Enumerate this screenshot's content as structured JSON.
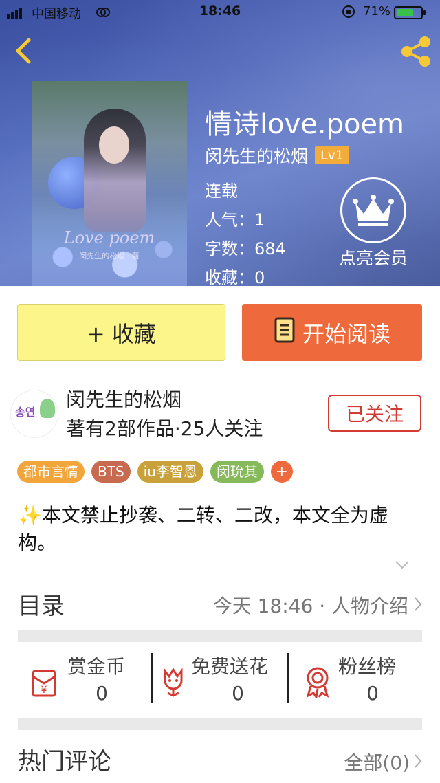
{
  "status_bar": {
    "carrier": "中国移动",
    "time": "18:46",
    "battery_percent": "71%",
    "battery_level": 0.71
  },
  "book": {
    "title": "情诗love.poem",
    "author": "闵先生的松烟",
    "level": "Lv1",
    "status": "连载",
    "popularity": "人气：1",
    "word_count": "字数：684",
    "favorites": "收藏：0",
    "cover_title": "Love poem",
    "cover_subtitle": "闵先生的松烟 · 著"
  },
  "vip": {
    "label": "点亮会员"
  },
  "actions": {
    "collect_label": "+ 收藏",
    "read_label": "开始阅读"
  },
  "author_card": {
    "name": "闵先生的松烟",
    "info": "著有2部作品·25人关注",
    "follow_label": "已关注",
    "avatar_text": "송연"
  },
  "tags": [
    {
      "label": "都市言情",
      "color": "#f2a53a"
    },
    {
      "label": "BTS",
      "color": "#c86a50"
    },
    {
      "label": "iu李智恩",
      "color": "#c9a13a"
    },
    {
      "label": "闵玧其",
      "color": "#86b95a"
    }
  ],
  "tag_add_label": "+",
  "description": "✨本文禁止抄袭、二转、二改，本文全为虚构。",
  "toc": {
    "label": "目录",
    "latest": "今天 18:46 · 人物介绍"
  },
  "gifts": [
    {
      "name": "赏金币",
      "value": "0",
      "icon": "red-packet-icon"
    },
    {
      "name": "免费送花",
      "value": "0",
      "icon": "flower-icon"
    },
    {
      "name": "粉丝榜",
      "value": "0",
      "icon": "medal-icon"
    }
  ],
  "comments": {
    "label": "热门评论",
    "all_label": "全部(0)"
  },
  "colors": {
    "accent_orange": "#ee6a3d",
    "collect_yellow": "#fbf58a",
    "follow_red": "#d33a32",
    "level_badge": "#f3ac3a",
    "header_icons": "#f7c934"
  }
}
